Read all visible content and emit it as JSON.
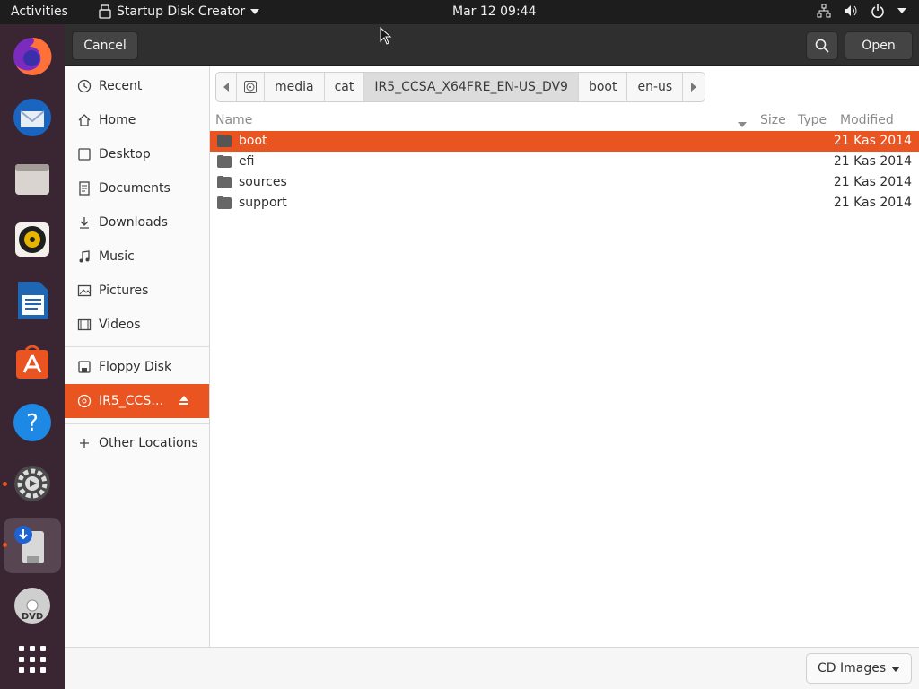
{
  "topbar": {
    "activities": "Activities",
    "app_name": "Startup Disk Creator",
    "clock": "Mar 12  09:44"
  },
  "dock": {
    "items": [
      "firefox-icon",
      "thunderbird-icon",
      "files-icon",
      "rhythmbox-icon",
      "libreoffice-writer-icon",
      "ubuntu-software-icon",
      "help-icon",
      "settings-icon",
      "startup-disk-creator-icon",
      "dvd-icon",
      "show-apps-icon"
    ]
  },
  "header": {
    "cancel_label": "Cancel",
    "open_label": "Open"
  },
  "sidebar": {
    "items": [
      {
        "label": "Recent",
        "icon": "clock-icon"
      },
      {
        "label": "Home",
        "icon": "home-icon"
      },
      {
        "label": "Desktop",
        "icon": "desktop-icon"
      },
      {
        "label": "Documents",
        "icon": "document-icon"
      },
      {
        "label": "Downloads",
        "icon": "download-icon"
      },
      {
        "label": "Music",
        "icon": "music-icon"
      },
      {
        "label": "Pictures",
        "icon": "picture-icon"
      },
      {
        "label": "Videos",
        "icon": "video-icon"
      }
    ],
    "devices": [
      {
        "label": "Floppy Disk",
        "icon": "floppy-icon"
      },
      {
        "label": "IR5_CCS…",
        "icon": "optical-disc-icon",
        "selected": true
      }
    ],
    "other": {
      "label": "Other Locations",
      "icon": "plus-icon"
    }
  },
  "pathbar": {
    "crumbs": [
      "media",
      "cat",
      "IR5_CCSA_X64FRE_EN-US_DV9",
      "boot",
      "en-us"
    ],
    "current_index": 2
  },
  "columns": {
    "name": "Name",
    "size": "Size",
    "type": "Type",
    "modified": "Modified"
  },
  "files": [
    {
      "name": "boot",
      "modified": "21 Kas 2014",
      "selected": true
    },
    {
      "name": "efi",
      "modified": "21 Kas 2014"
    },
    {
      "name": "sources",
      "modified": "21 Kas 2014"
    },
    {
      "name": "support",
      "modified": "21 Kas 2014"
    }
  ],
  "footer": {
    "filter_label": "CD Images"
  },
  "colors": {
    "accent": "#e95420",
    "dock_bg": "#3a2533",
    "topbar_bg": "#1d1d1d",
    "headerbar_bg": "#2f2f2f"
  }
}
